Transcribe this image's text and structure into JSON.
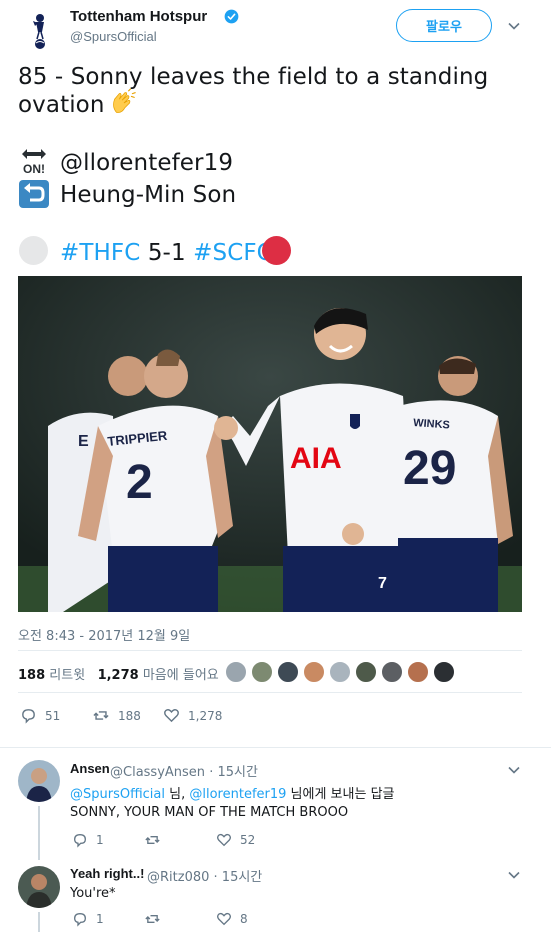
{
  "header": {
    "display_name": "Tottenham Hotspur",
    "handle": "@SpursOfficial",
    "follow_label": "팔로우"
  },
  "tweet": {
    "line1": "85 - Sonny leaves the field to a standing",
    "line2": "ovation",
    "on_mention": "@llorentefer19",
    "off_player": "Heung-Min Son",
    "hashtag_home": "#THFC",
    "score": "5-1",
    "hashtag_away": "#SCFC",
    "on_icon_text": "ON!"
  },
  "photo": {
    "shirt_left": "TRIPPIER",
    "number_left": "2",
    "shirt_right": "WINKS",
    "number_right": "29",
    "sponsor": "AIA",
    "number_center": "7",
    "partial_left": "E"
  },
  "meta": {
    "timestamp": "오전 8:43 - 2017년 12월 9일",
    "retweets_count": "188",
    "retweets_label": "리트윗",
    "likes_count": "1,278",
    "likes_label": "마음에 들어요"
  },
  "actions": {
    "reply_count": "51",
    "retweet_count": "188",
    "like_count": "1,278"
  },
  "replies": [
    {
      "name": "Ansen",
      "handle": "@ClassyAnsen",
      "time": "· 15시간",
      "reply_to_a": "@SpursOfficial",
      "reply_to_sep": "님,",
      "reply_to_b": "@llorentefer19",
      "reply_to_suffix": "님에게 보내는 답글",
      "text": "SONNY, YOUR MAN OF THE MATCH BROOO",
      "reply_count": "1",
      "retweet_count": "",
      "like_count": "52"
    },
    {
      "name": "Yeah right..!",
      "handle": "@Ritz080",
      "time": "· 15시간",
      "text": "You're*",
      "reply_count": "1",
      "retweet_count": "",
      "like_count": "8"
    }
  ],
  "colors": {
    "accent": "#1da1f2",
    "muted": "#657786",
    "spurs_navy": "#132257"
  }
}
